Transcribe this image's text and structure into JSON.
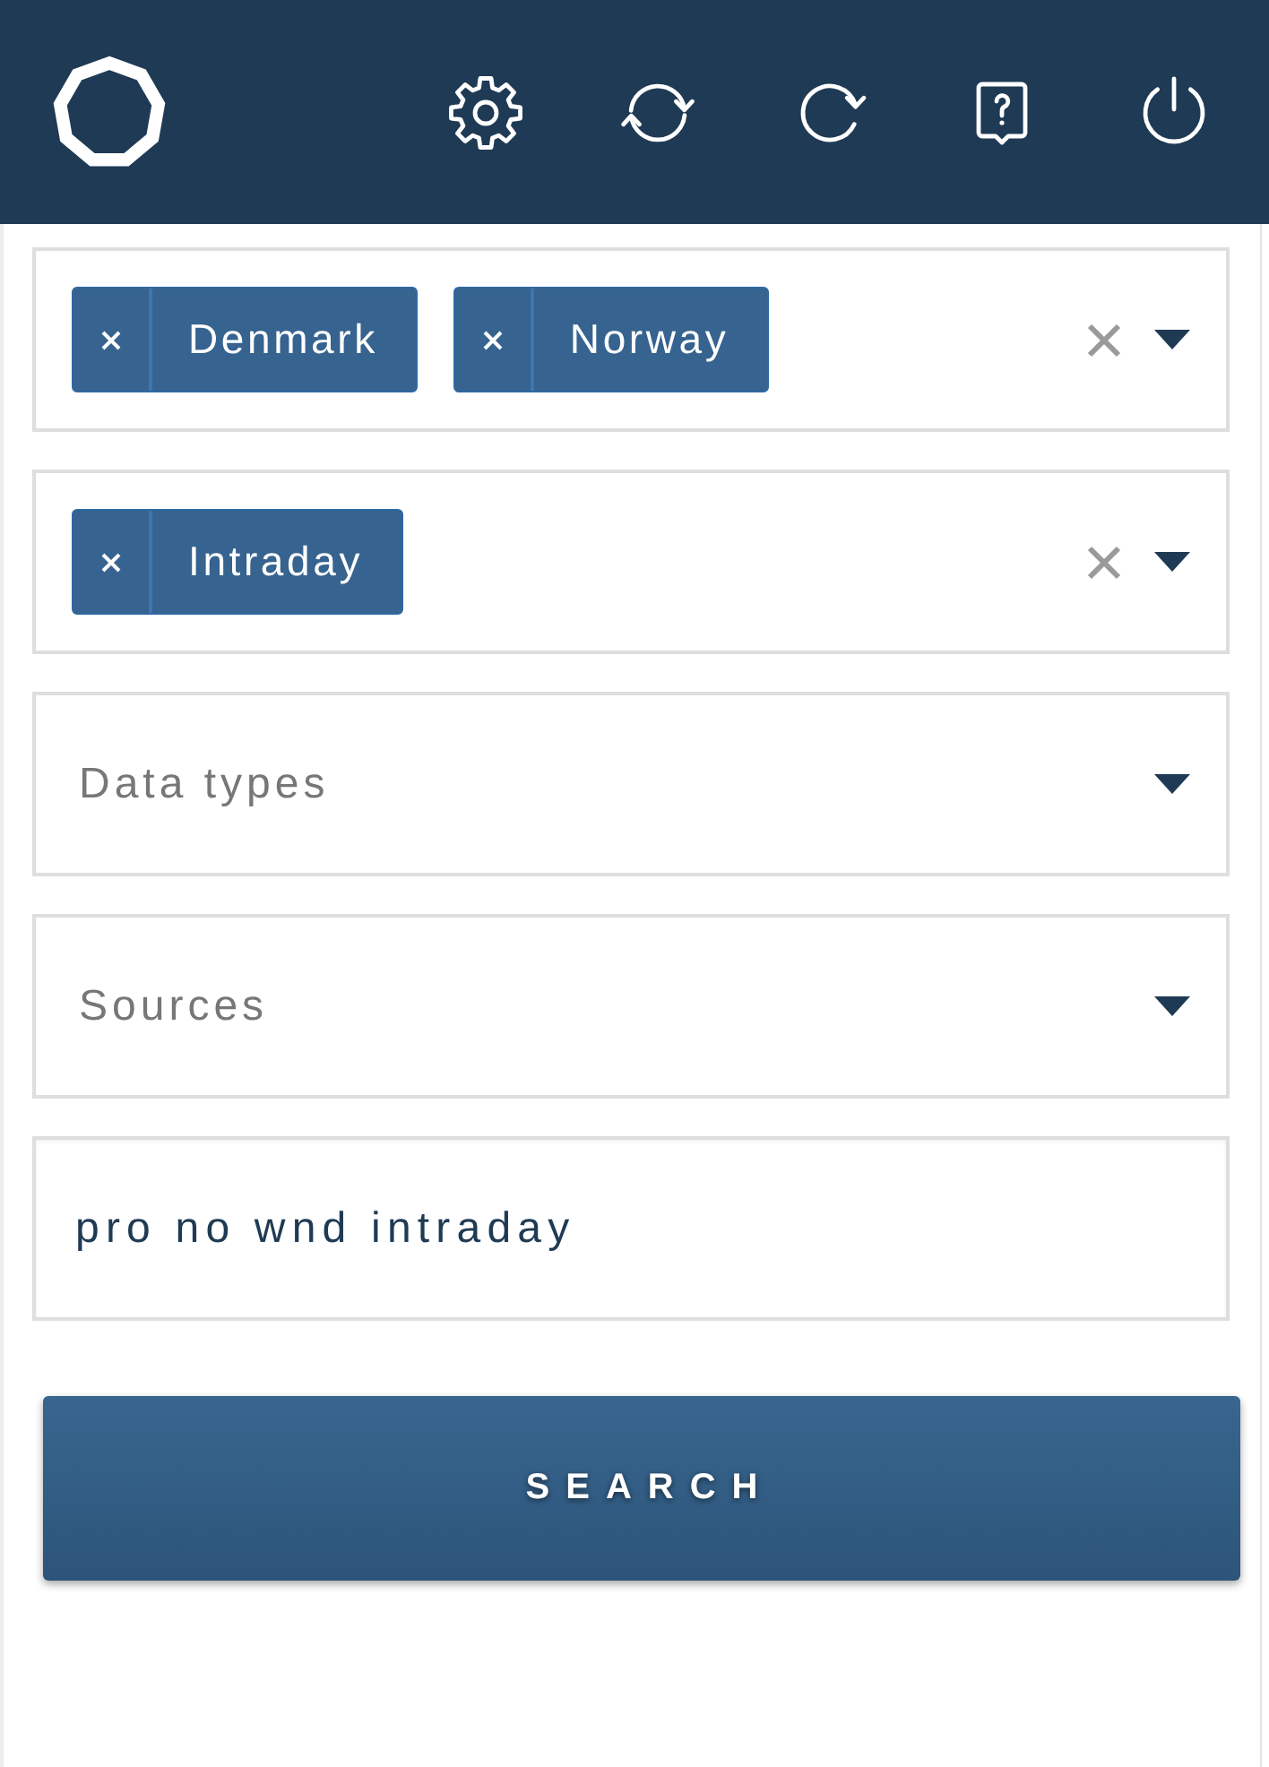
{
  "filters": [
    {
      "kind": "multiselect",
      "chips": [
        "Denmark",
        "Norway"
      ]
    },
    {
      "kind": "multiselect",
      "chips": [
        "Intraday"
      ]
    },
    {
      "kind": "select",
      "placeholder": "Data types"
    },
    {
      "kind": "select",
      "placeholder": "Sources"
    }
  ],
  "search_field": {
    "value": "pro no wnd intraday"
  },
  "search_button": {
    "label": "SEARCH"
  }
}
